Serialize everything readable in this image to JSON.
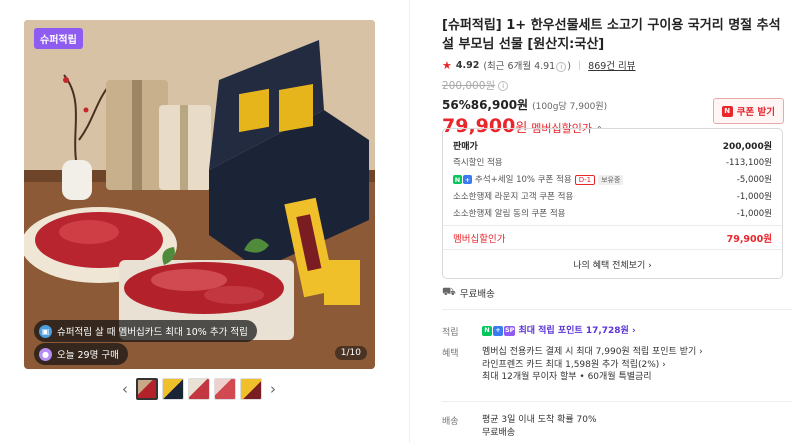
{
  "gallery": {
    "badge": "슈퍼적립",
    "promo_line_1": "슈퍼적립 살 때 멤버십카드 최대 10% 추가 적립",
    "promo_line_2": "오늘 29명 구매",
    "counter": "1/10",
    "thumb_count": 5
  },
  "product": {
    "title": "[슈퍼적립] 1+ 한우선물세트 소고기 구이용 국거리 명절 추석 설 부모님 선물 [원산지:국산]",
    "rating": "4.92",
    "rating_recent": "(최근 6개월 4.91",
    "rating_recent_close": ")",
    "review_count": "869건 리뷰",
    "original_price": "200,000원",
    "discount_rate": "56%",
    "sale_price": "86,900원",
    "unit_price": "(100g당 7,900원)",
    "member_price": "79,900",
    "member_price_unit": "원",
    "member_price_label": "멤버십할인가",
    "coupon_button": "쿠폰 받기"
  },
  "breakdown": {
    "rows": [
      {
        "label": "판매가",
        "value": "200,000원"
      },
      {
        "label": "즉시할인 적용",
        "value": "-113,100원"
      },
      {
        "label": "추석+세일 10% 쿠폰 적용",
        "value": "-5,000원",
        "tag_d": "D-1",
        "tag_own": "보유중"
      },
      {
        "label": "소소한행제 라운지 고객 쿠폰 적용",
        "value": "-1,000원"
      },
      {
        "label": "소소한행제 알림 동의 쿠폰 적용",
        "value": "-1,000원"
      }
    ],
    "total_label": "멤버십할인가",
    "total_value": "79,900원",
    "benefit_link": "나의 혜택 전체보기"
  },
  "shipping_top": "무료배송",
  "details": {
    "point_label": "적립",
    "point_text": "최대 적립 포인트 17,728원",
    "benefit_label": "혜택",
    "benefit_lines": [
      "멤버십 전용카드 결제 시 최대 7,990원 적립 포인트 받기",
      "라인프렌즈 카드 최대 1,598원 추가 적립(2%)",
      "최대 12개월 무이자 할부 • 60개월 특별금리"
    ],
    "shipping_label": "배송",
    "shipping_lines": [
      "평균 3일 이내 도착 확률 70%",
      "무료배송"
    ]
  },
  "colors": {
    "accent": "#e8262c",
    "point": "#5a33d6",
    "badge_purple": "#8e5cf0",
    "npay_green": "#03c75a"
  }
}
